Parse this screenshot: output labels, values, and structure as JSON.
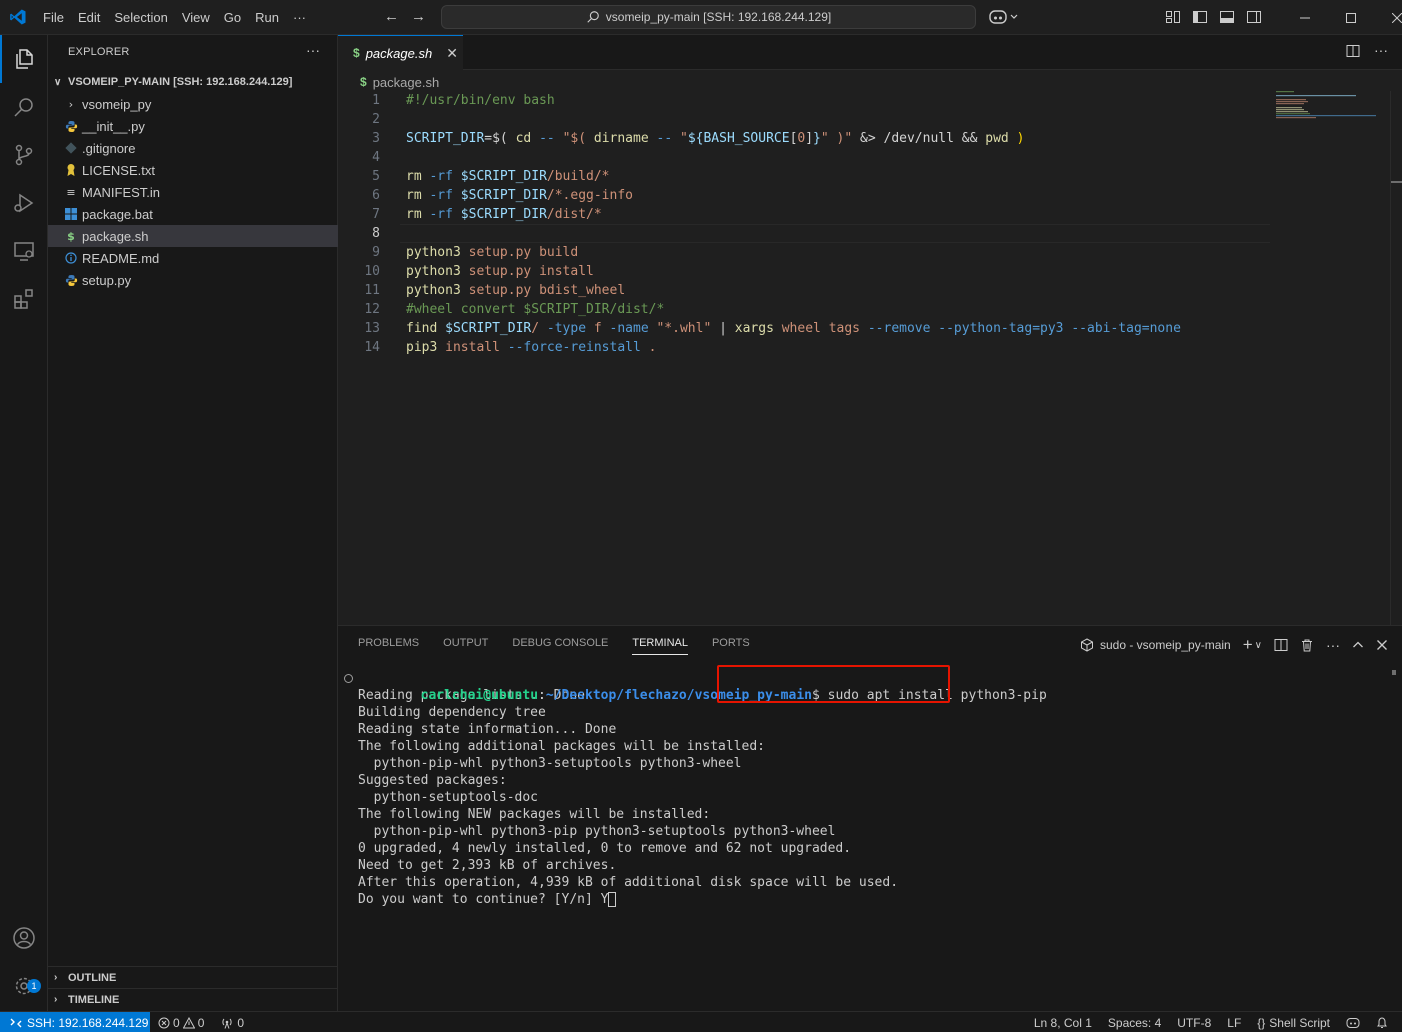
{
  "titlebar": {
    "menu": [
      "File",
      "Edit",
      "Selection",
      "View",
      "Go",
      "Run",
      "···"
    ],
    "search": "vsomeip_py-main [SSH: 192.168.244.129]"
  },
  "explorer": {
    "title": "EXPLORER",
    "more": "···",
    "folder": "VSOMEIP_PY-MAIN [SSH: 192.168.244.129]",
    "items": [
      {
        "label": "vsomeip_py",
        "icon": "chevron-right-icon"
      },
      {
        "label": "__init__.py",
        "icon": "python-icon"
      },
      {
        "label": ".gitignore",
        "icon": "git-icon"
      },
      {
        "label": "LICENSE.txt",
        "icon": "license-icon"
      },
      {
        "label": "MANIFEST.in",
        "icon": "lines-icon"
      },
      {
        "label": "package.bat",
        "icon": "windows-icon"
      },
      {
        "label": "package.sh",
        "icon": "shell-icon"
      },
      {
        "label": "README.md",
        "icon": "info-icon"
      },
      {
        "label": "setup.py",
        "icon": "python-icon"
      }
    ],
    "outline": "OUTLINE",
    "timeline": "TIMELINE"
  },
  "editor": {
    "tab_label": "package.sh",
    "breadcrumb": "package.sh",
    "line_numbers": [
      "1",
      "2",
      "3",
      "4",
      "5",
      "6",
      "7",
      "8",
      "9",
      "10",
      "11",
      "12",
      "13",
      "14"
    ],
    "current_line": 8
  },
  "panel": {
    "tabs": [
      "PROBLEMS",
      "OUTPUT",
      "DEBUG CONSOLE",
      "TERMINAL",
      "PORTS"
    ],
    "active_tab": "TERMINAL",
    "terminal_name": "sudo - vsomeip_py-main",
    "prompt_user": "carlchai@ubuntu",
    "prompt_path": "~/Desktop/flechazo/vsomeip_py-main",
    "command": "sudo apt install python3-pip",
    "output": [
      "Reading package lists... Done",
      "Building dependency tree",
      "Reading state information... Done",
      "The following additional packages will be installed:",
      "  python-pip-whl python3-setuptools python3-wheel",
      "Suggested packages:",
      "  python-setuptools-doc",
      "The following NEW packages will be installed:",
      "  python-pip-whl python3-pip python3-setuptools python3-wheel",
      "0 upgraded, 4 newly installed, 0 to remove and 62 not upgraded.",
      "Need to get 2,393 kB of archives.",
      "After this operation, 4,939 kB of additional disk space will be used."
    ],
    "last_line": "Do you want to continue? [Y/n] Y"
  },
  "statusbar": {
    "remote": "SSH: 192.168.244.129",
    "errors": "0",
    "warnings": "0",
    "ports": "0",
    "position": "Ln 8, Col 1",
    "spaces": "Spaces: 4",
    "encoding": "UTF-8",
    "eol": "LF",
    "language": "Shell Script",
    "accounts_badge": "1"
  },
  "colors": {
    "accent": "#0078d4",
    "highlight_box": "#e51400",
    "prompt_user": "#23d18b",
    "prompt_path": "#3b8eea"
  }
}
